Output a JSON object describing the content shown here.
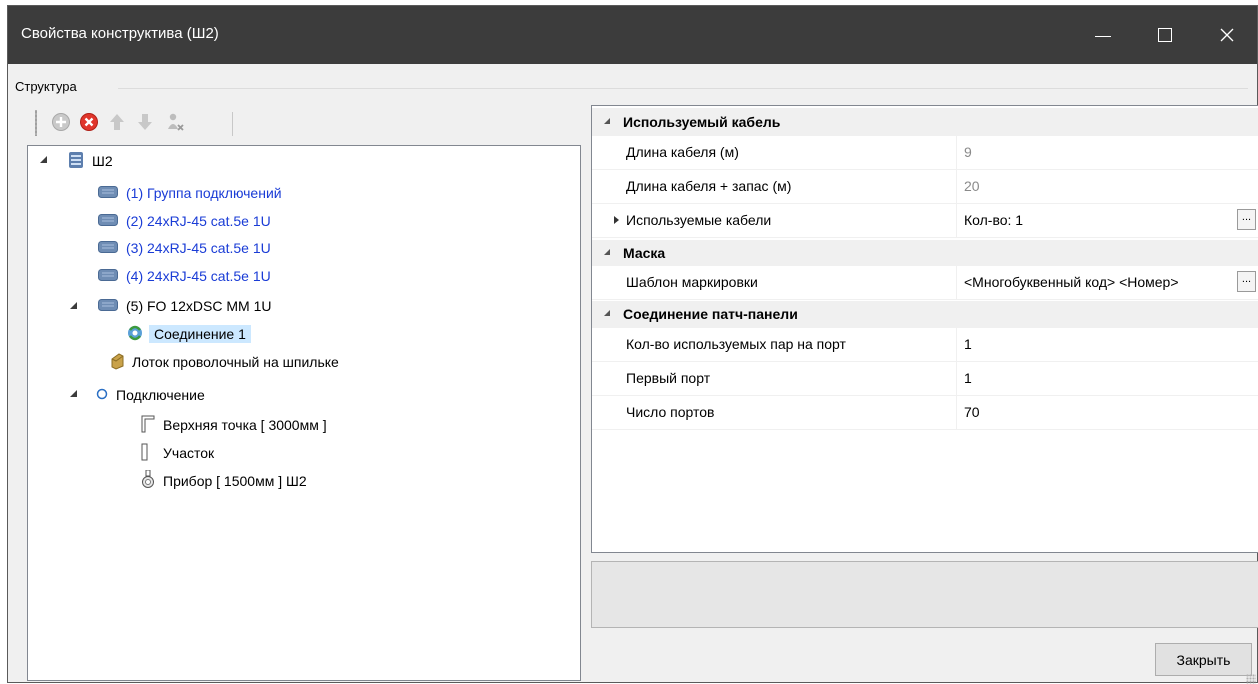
{
  "window": {
    "title": "Свойства конструктива (Ш2)"
  },
  "structure": {
    "label": "Структура",
    "toolbar": [
      "add-icon",
      "delete-icon",
      "move-up-icon",
      "move-down-icon",
      "unlink-icon"
    ],
    "tree": [
      {
        "label": "Ш2",
        "icon": "cabinet-icon"
      },
      {
        "label": "(1) Группа подключений",
        "icon": "panel-icon"
      },
      {
        "label": "(2) 24xRJ-45 cat.5e 1U",
        "icon": "panel-icon"
      },
      {
        "label": "(3) 24xRJ-45 cat.5e 1U",
        "icon": "panel-icon"
      },
      {
        "label": "(4) 24xRJ-45 cat.5e 1U",
        "icon": "panel-icon"
      },
      {
        "label": "(5) FO 12xDSC MM 1U",
        "icon": "panel-icon"
      },
      {
        "label": "Соединение 1",
        "icon": "connection-icon",
        "selected": true
      },
      {
        "label": "Лоток проволочный на шпильке",
        "icon": "tray-icon"
      },
      {
        "label": "Подключение",
        "icon": "circle-icon"
      },
      {
        "label": "Верхняя точка [ 3000мм ]",
        "icon": "corner-icon"
      },
      {
        "label": "Участок",
        "icon": "segment-icon"
      },
      {
        "label": "Прибор [ 1500мм ] Ш2",
        "icon": "device-icon"
      }
    ]
  },
  "properties": {
    "cat_cable": "Используемый кабель",
    "cable_length": {
      "name": "Длина кабеля (м)",
      "value": "9"
    },
    "cable_length_reserve": {
      "name": "Длина кабеля + запас (м)",
      "value": "20"
    },
    "used_cables": {
      "name": "Используемые кабели",
      "value": "Кол-во: 1"
    },
    "cat_mask": "Маска",
    "marking_template": {
      "name": "Шаблон маркировки",
      "value": "<Многобуквенный код> <Номер>"
    },
    "cat_patch": "Соединение патч-панели",
    "pairs_per_port": {
      "name": "Кол-во используемых пар на порт",
      "value": "1"
    },
    "first_port": {
      "name": "Первый порт",
      "value": "1"
    },
    "ports_count": {
      "name": "Число портов",
      "value": "70"
    },
    "ellipsis": "..."
  },
  "buttons": {
    "close": "Закрыть"
  }
}
